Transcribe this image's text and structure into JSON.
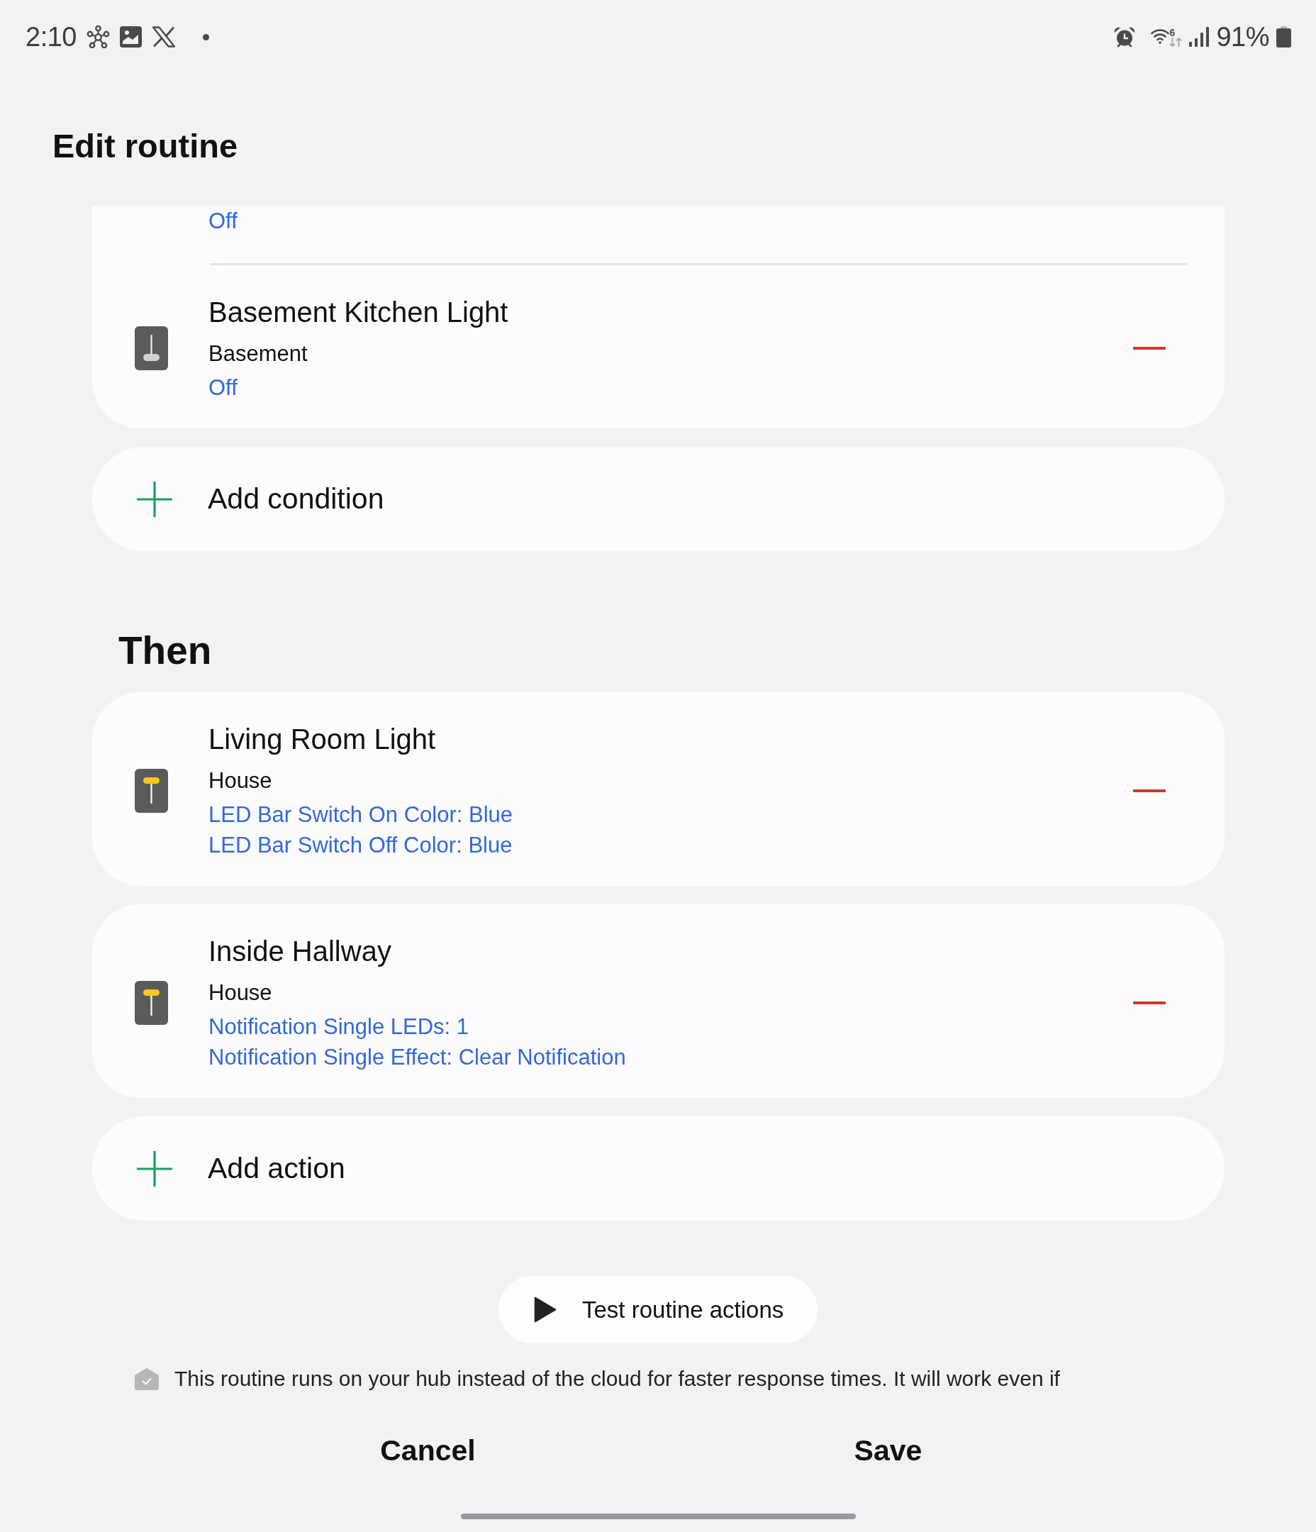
{
  "status_bar": {
    "time": "2:10",
    "wifi_label": "6",
    "battery": "91%"
  },
  "title": "Edit routine",
  "if_section": {
    "conditions": [
      {
        "status": [
          "Off"
        ]
      },
      {
        "name": "Basement Kitchen Light",
        "location": "Basement",
        "status": [
          "Off"
        ],
        "on": false
      }
    ],
    "add_label": "Add condition"
  },
  "then_section": {
    "heading": "Then",
    "actions": [
      {
        "name": "Living Room Light",
        "location": "House",
        "status": [
          "LED Bar Switch On Color: Blue",
          "LED Bar Switch Off Color: Blue"
        ],
        "on": true
      },
      {
        "name": "Inside Hallway",
        "location": "House",
        "status": [
          "Notification Single LEDs: 1",
          "Notification Single Effect: Clear Notification"
        ],
        "on": true
      }
    ],
    "add_label": "Add action"
  },
  "test_button": "Test routine actions",
  "local_note": "This routine runs on your hub instead of the cloud for faster response times. It will work even if",
  "buttons": [
    "Cancel",
    "Save"
  ]
}
